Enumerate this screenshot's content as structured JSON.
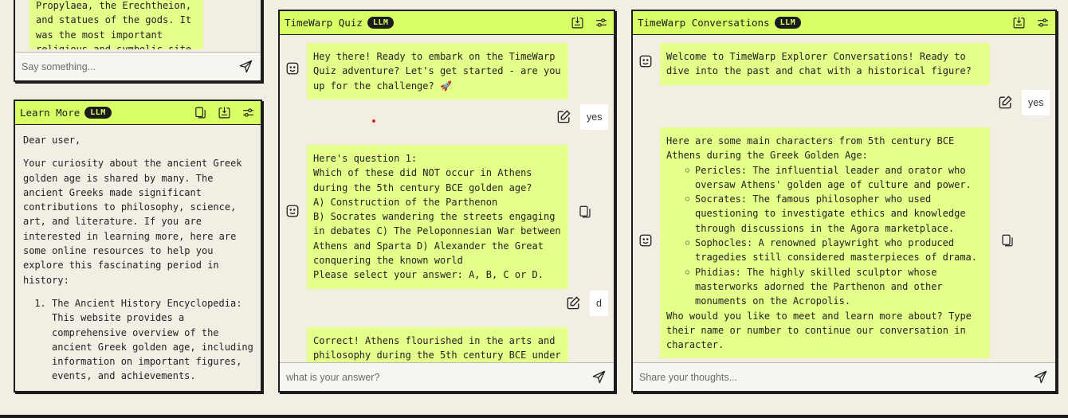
{
  "top_panel": {
    "visible_text": "Propylaea, the Erechtheion,\nand statues of the gods. It\nwas the most important\nreligious and symbolic site",
    "input_placeholder": "Say something..."
  },
  "learn_more": {
    "title": "Learn More",
    "badge": "LLM",
    "greeting": "Dear user,",
    "body": "Your curiosity about the ancient Greek golden age is shared by many. The ancient Greeks made significant contributions to philosophy, science, art, and literature. If you are interested in learning more, here are some online resources to help you explore this fascinating period in history:",
    "list": [
      "The Ancient History Encyclopedia: This website provides a comprehensive overview of the ancient Greek golden age, including information on important figures, events, and achievements."
    ]
  },
  "quiz": {
    "title": "TimeWarp Quiz",
    "badge": "LLM",
    "messages": {
      "bot1": "Hey there! Ready to embark on the TimeWarp Quiz adventure? Let's get started - are you up for the challenge? 🚀",
      "user1": "yes",
      "bot2": "Here's question 1:\nWhich of these did NOT occur in Athens during the 5th century BCE golden age?\nA) Construction of the Parthenon\nB) Socrates wandering the streets engaging in debates C) The Peloponnesian War between Athens and Sparta D) Alexander the Great conquering the known world\nPlease select your answer: A, B, C or D.",
      "user2": "d",
      "bot3": "Correct! Athens flourished in the arts and philosophy during the 5th century BCE under"
    },
    "input_placeholder": "what is your answer?"
  },
  "conversations": {
    "title": "TimeWarp Conversations",
    "badge": "LLM",
    "messages": {
      "bot1": "Welcome to TimeWarp Explorer Conversations! Ready to dive into the past and chat with a historical figure?",
      "user1": "yes",
      "bot2_intro": "Here are some main characters from 5th century BCE Athens during the Greek Golden Age:",
      "bot2_list": [
        "Pericles: The influential leader and orator who oversaw Athens' golden age of culture and power.",
        "Socrates: The famous philosopher who used questioning to investigate ethics and knowledge through discussions in the Agora marketplace.",
        "Sophocles: A renowned playwright who produced tragedies still considered masterpieces of drama.",
        "Phidias: The highly skilled sculptor whose masterworks adorned the Parthenon and other monuments on the Acropolis."
      ],
      "bot2_outro": "Who would you like to meet and learn more about? Type their name or number to continue our conversation in character."
    },
    "input_placeholder": "Share your thoughts..."
  },
  "colors": {
    "accent": "#d9ff66",
    "bubble": "#e4ff8a",
    "background": "#f2eee4",
    "ink": "#1c1c1c"
  }
}
